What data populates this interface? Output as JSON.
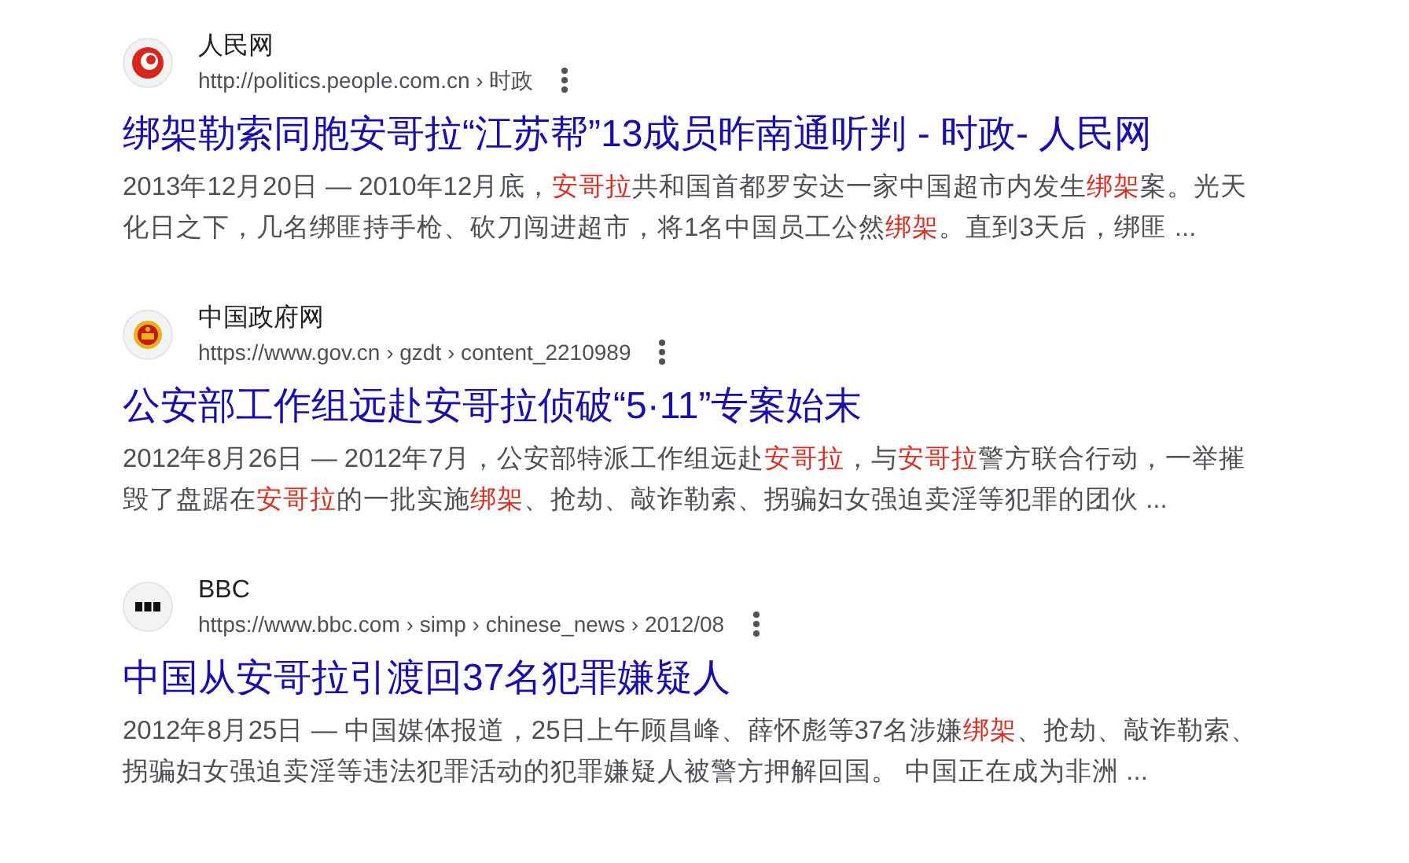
{
  "results": [
    {
      "site": "人民网",
      "kind": "swirl",
      "url": "http://politics.people.com.cn › 时政",
      "title": "绑架勒索同胞安哥拉“江苏帮”13成员昨南通听判 - 时政- 人民网",
      "snippet_lines": [
        [
          {
            "text": "2013年12月20日 — 2010年12月底，",
            "highlighted": false
          },
          {
            "text": "安哥拉",
            "highlighted": true
          },
          {
            "text": "共和国首都罗安达一家中国超市内发生",
            "highlighted": false
          },
          {
            "text": "绑架",
            "highlighted": true
          },
          {
            "text": "案。光天",
            "highlighted": false
          }
        ],
        [
          {
            "text": "化日之下，几名绑匪持手枪、砍刀闯进超市，将1名中国员工公然",
            "highlighted": false
          },
          {
            "text": "绑架",
            "highlighted": true
          },
          {
            "text": "。直到3天后，绑匪 ...",
            "highlighted": false
          }
        ]
      ]
    },
    {
      "site": "中国政府网",
      "kind": "emblem",
      "url": "https://www.gov.cn › gzdt › content_2210989",
      "title": "公安部工作组远赴安哥拉侦破“5·11”专案始末",
      "snippet_lines": [
        [
          {
            "text": "2012年8月26日 — 2012年7月，公安部特派工作组远赴",
            "highlighted": false
          },
          {
            "text": "安哥拉",
            "highlighted": true
          },
          {
            "text": "，与",
            "highlighted": false
          },
          {
            "text": "安哥拉",
            "highlighted": true
          },
          {
            "text": "警方联合行动，一举摧",
            "highlighted": false
          }
        ],
        [
          {
            "text": "毁了盘踞在",
            "highlighted": false
          },
          {
            "text": "安哥拉",
            "highlighted": true
          },
          {
            "text": "的一批实施",
            "highlighted": false
          },
          {
            "text": "绑架",
            "highlighted": true
          },
          {
            "text": "、抢劫、敲诈勒索、拐骗妇女强迫卖淫等犯罪的团伙 ...",
            "highlighted": false
          }
        ]
      ]
    },
    {
      "site": "BBC",
      "kind": "blocks",
      "url": "https://www.bbc.com › simp › chinese_news › 2012/08",
      "title": "中国从安哥拉引渡回37名犯罪嫌疑人",
      "snippet_lines": [
        [
          {
            "text": "2012年8月25日 — 中国媒体报道，25日上午顾昌峰、薛怀彪等37名涉嫌",
            "highlighted": false
          },
          {
            "text": "绑架",
            "highlighted": true
          },
          {
            "text": "、抢劫、敲诈勒索、",
            "highlighted": false
          }
        ],
        [
          {
            "text": "拐骗妇女强迫卖淫等违法犯罪活动的犯罪嫌疑人被警方押解回国。 中国正在成为非洲 ...",
            "highlighted": false
          }
        ]
      ]
    }
  ]
}
